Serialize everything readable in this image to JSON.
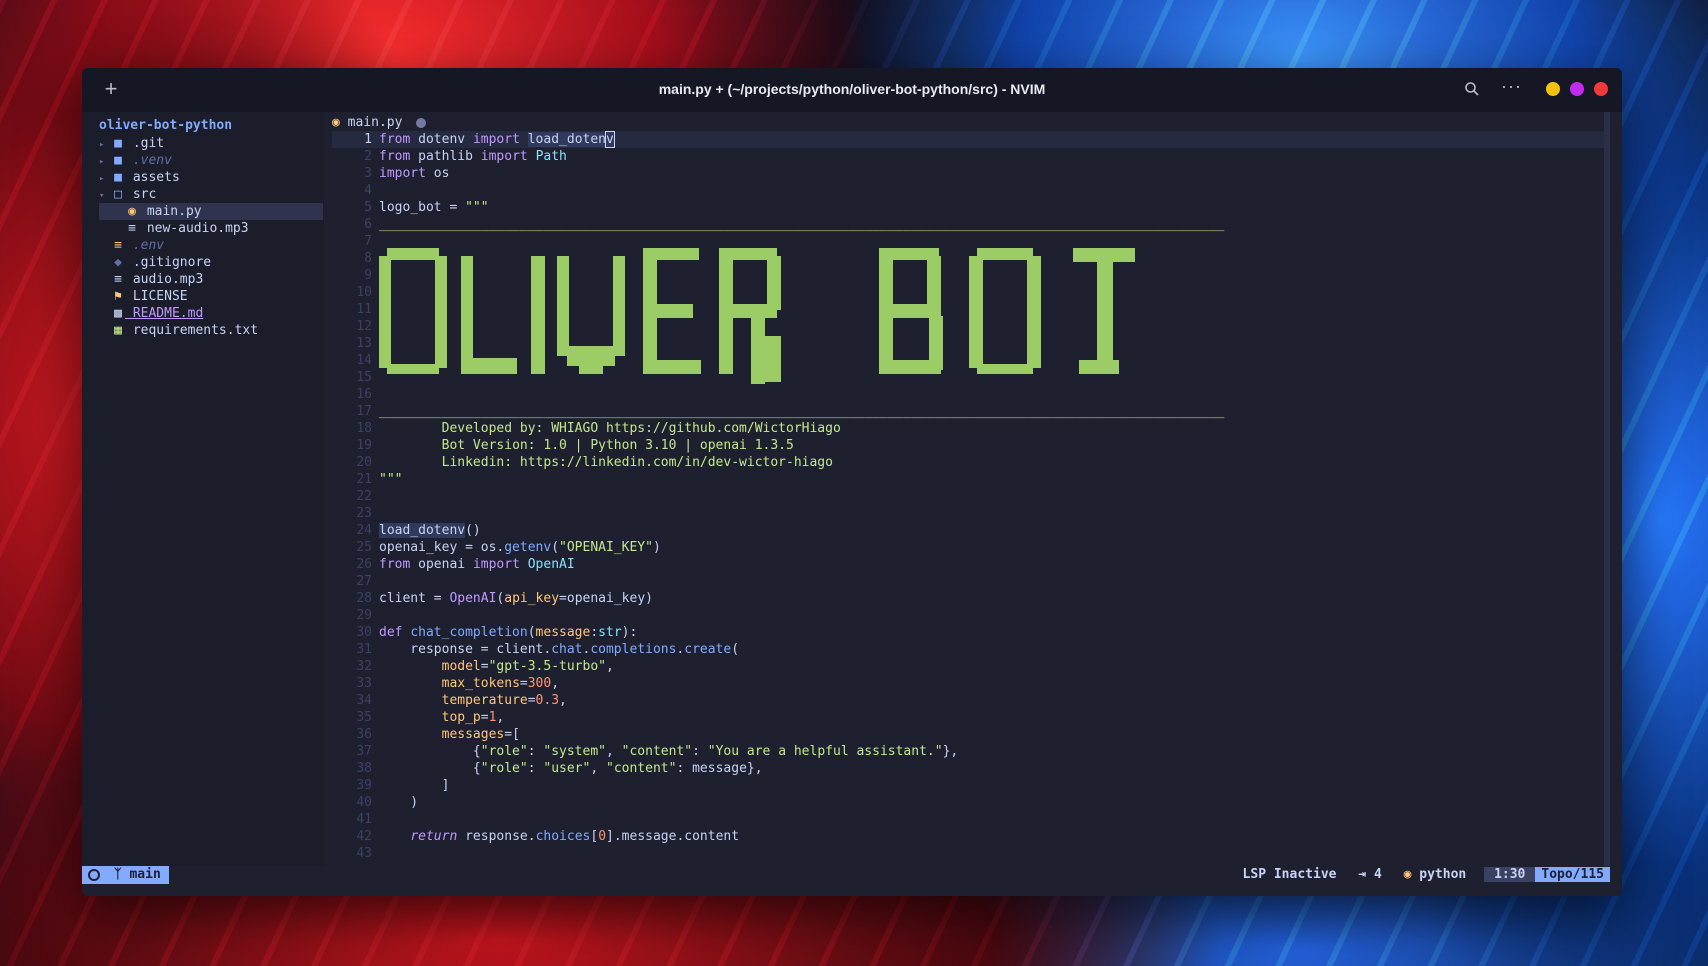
{
  "window": {
    "title": "main.py + (~/projects/python/oliver-bot-python/src) - NVIM"
  },
  "tree": {
    "root": "oliver-bot-python",
    "items": [
      {
        "label": ".git",
        "type": "folder",
        "expanded": false,
        "dim": false,
        "indent": 0
      },
      {
        "label": ".venv",
        "type": "folder",
        "expanded": false,
        "dim": true,
        "indent": 0
      },
      {
        "label": "assets",
        "type": "folder",
        "expanded": false,
        "dim": false,
        "indent": 0
      },
      {
        "label": "src",
        "type": "folder",
        "expanded": true,
        "dim": false,
        "indent": 0
      },
      {
        "label": "main.py",
        "type": "python",
        "dim": false,
        "indent": 1,
        "selected": true
      },
      {
        "label": "new-audio.mp3",
        "type": "file",
        "dim": false,
        "indent": 1
      },
      {
        "label": ".env",
        "type": "env",
        "dim": true,
        "indent": 0
      },
      {
        "label": ".gitignore",
        "type": "git",
        "dim": false,
        "indent": 0
      },
      {
        "label": "audio.mp3",
        "type": "file",
        "dim": false,
        "indent": 0
      },
      {
        "label": "LICENSE",
        "type": "license",
        "dim": false,
        "indent": 0
      },
      {
        "label": "README.md",
        "type": "markdown",
        "dim": false,
        "indent": 0
      },
      {
        "label": "requirements.txt",
        "type": "text",
        "dim": false,
        "indent": 0
      }
    ]
  },
  "tab": {
    "filename": "main.py"
  },
  "editor": {
    "line_count": 43,
    "ascii_art_text": "OLIVER BOT",
    "dash_line": "____________________________________________________________________________________________________________",
    "credits": [
      "Developed by: WHIAGO https://github.com/WictorHiago",
      "Bot Version: 1.0 | Python 3.10 | openai 1.3.5",
      "Linkedin: https://linkedin.com/in/dev-wictor-hiago"
    ]
  },
  "status": {
    "branch": "main",
    "lsp": "LSP Inactive",
    "indent": "4",
    "filetype": "python",
    "position": "1:30",
    "percent": "Topo/115"
  },
  "colors": {
    "accent": "#82aaff",
    "string": "#c3e88d",
    "keyword": "#c099ff",
    "ascii": "#9ccc65"
  }
}
